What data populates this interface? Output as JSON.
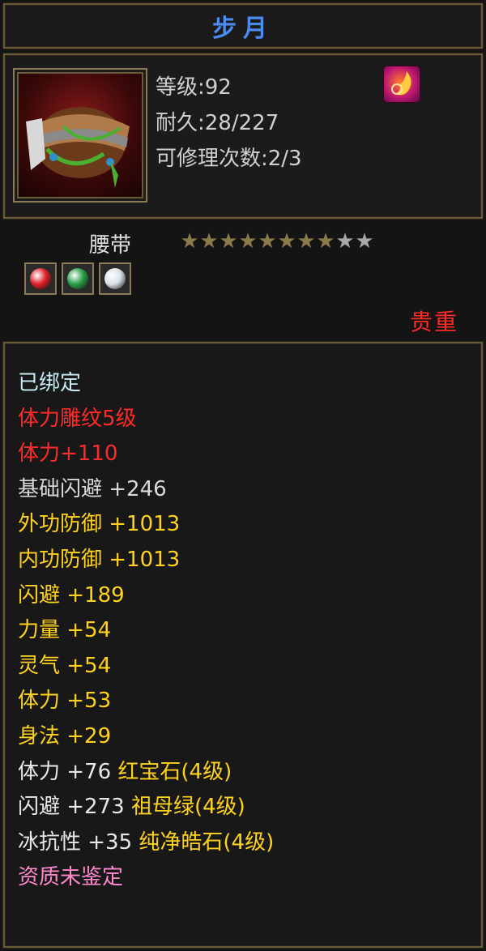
{
  "title": "步月",
  "meta": {
    "level": "等级:92",
    "durability": "耐久:28/227",
    "repairs": "可修理次数:2/3"
  },
  "item_type": "腰带",
  "stars": {
    "filled": 8,
    "total": 10,
    "filled_color": "#8a7a4a",
    "empty_color": "#a8a8a8"
  },
  "gems": [
    {
      "name": "red-gem-icon",
      "color": "#e0202a"
    },
    {
      "name": "green-gem-icon",
      "color": "#2aa048"
    },
    {
      "name": "white-gem-icon",
      "color": "#d8e0e8"
    }
  ],
  "rarity": "贵重",
  "properties": [
    {
      "parts": [
        {
          "text": "已绑定",
          "color": "#c8ecf4"
        }
      ]
    },
    {
      "parts": [
        {
          "text": "体力雕纹5级",
          "color": "#ff2a2a"
        }
      ]
    },
    {
      "parts": [
        {
          "text": "体力+110",
          "color": "#ff2a2a"
        }
      ]
    },
    {
      "parts": [
        {
          "text": "基础闪避 ",
          "color": "#d8d8d8"
        },
        {
          "text": "+246",
          "color": "#d8d8d8"
        }
      ]
    },
    {
      "parts": [
        {
          "text": "外功防御 ",
          "color": "#ffd21e"
        },
        {
          "text": "+1013",
          "color": "#ffd21e"
        }
      ]
    },
    {
      "parts": [
        {
          "text": "内功防御 ",
          "color": "#ffd21e"
        },
        {
          "text": "+1013",
          "color": "#ffd21e"
        }
      ]
    },
    {
      "parts": [
        {
          "text": "闪避 ",
          "color": "#ffd21e"
        },
        {
          "text": "+189",
          "color": "#ffd21e"
        }
      ]
    },
    {
      "parts": [
        {
          "text": "力量 ",
          "color": "#ffd21e"
        },
        {
          "text": "+54",
          "color": "#ffd21e"
        }
      ]
    },
    {
      "parts": [
        {
          "text": "灵气 ",
          "color": "#ffd21e"
        },
        {
          "text": "+54",
          "color": "#ffd21e"
        }
      ]
    },
    {
      "parts": [
        {
          "text": "体力 ",
          "color": "#ffd21e"
        },
        {
          "text": "+53",
          "color": "#ffd21e"
        }
      ]
    },
    {
      "parts": [
        {
          "text": "身法 ",
          "color": "#ffd21e"
        },
        {
          "text": "+29",
          "color": "#ffd21e"
        }
      ]
    },
    {
      "parts": [
        {
          "text": "体力 +76 ",
          "color": "#e8e8e8"
        },
        {
          "text": "红宝石(4级)",
          "color": "#ffd21e"
        }
      ]
    },
    {
      "parts": [
        {
          "text": "闪避 +273 ",
          "color": "#e8e8e8"
        },
        {
          "text": "祖母绿(4级)",
          "color": "#ffd21e"
        }
      ]
    },
    {
      "parts": [
        {
          "text": "冰抗性 +35 ",
          "color": "#e8e8e8"
        },
        {
          "text": "纯净皓石(4级)",
          "color": "#ffd21e"
        }
      ]
    },
    {
      "parts": [
        {
          "text": "资质未鉴定",
          "color": "#ff88cc"
        }
      ]
    }
  ]
}
